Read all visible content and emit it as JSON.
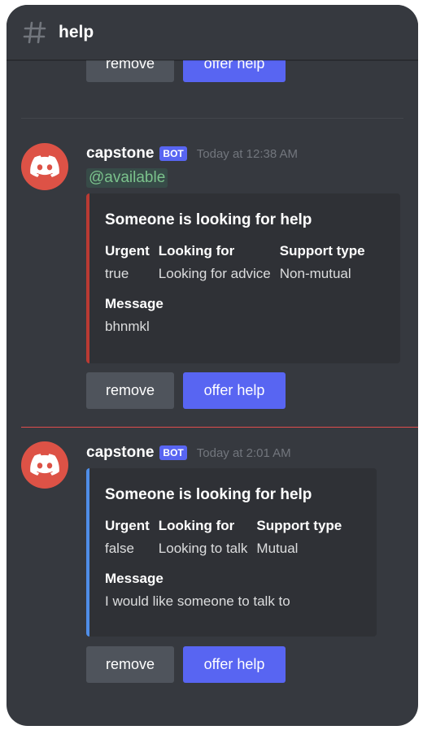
{
  "channel": {
    "name": "help"
  },
  "top_partial": {
    "remove_label": "remove",
    "offer_label": "offer help"
  },
  "messages": [
    {
      "author": "capstone",
      "badge": "BOT",
      "timestamp": "Today at 12:38 AM",
      "mention": "@available",
      "embed_color": "#ba3a33",
      "embed": {
        "title": "Someone is looking for help",
        "fields": [
          {
            "name": "Urgent",
            "value": "true"
          },
          {
            "name": "Looking for",
            "value": "Looking for advice"
          },
          {
            "name": "Support type",
            "value": "Non-mutual"
          }
        ],
        "message_name": "Message",
        "message_value": "bhnmkl"
      },
      "remove_label": "remove",
      "offer_label": "offer help"
    },
    {
      "author": "capstone",
      "badge": "BOT",
      "timestamp": "Today at 2:01 AM",
      "embed_color": "#4f8ee8",
      "embed": {
        "title": "Someone is looking for help",
        "fields": [
          {
            "name": "Urgent",
            "value": "false"
          },
          {
            "name": "Looking for",
            "value": "Looking to talk"
          },
          {
            "name": "Support type",
            "value": "Mutual"
          }
        ],
        "message_name": "Message",
        "message_value": "I would like someone to talk to"
      },
      "remove_label": "remove",
      "offer_label": "offer help"
    }
  ],
  "colors": {
    "background": "#36393f",
    "embed_bg": "#2f3136",
    "blurple": "#5865f2",
    "secondary_button": "#4f545c",
    "avatar": "#dd5246",
    "new_messages_divider": "#e04d4d"
  },
  "icons": {
    "channel": "hash-icon",
    "avatar": "discord-logo-icon"
  }
}
